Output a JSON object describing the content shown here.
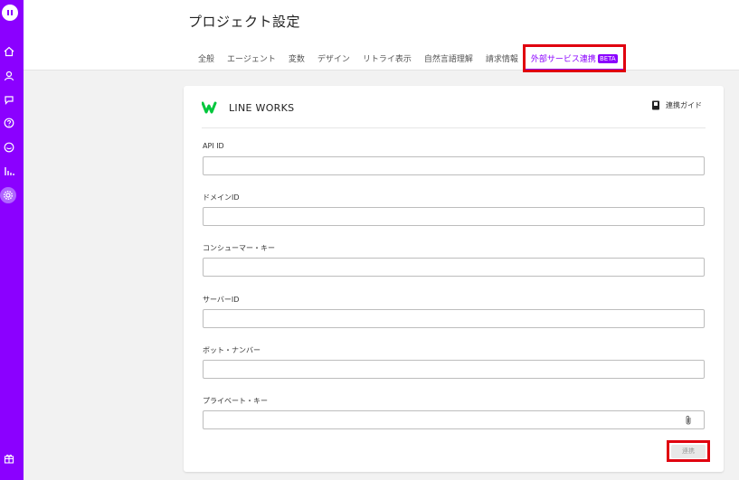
{
  "header": {
    "title": "プロジェクト設定",
    "tabs": [
      {
        "label": "全般"
      },
      {
        "label": "エージェント"
      },
      {
        "label": "変数"
      },
      {
        "label": "デザイン"
      },
      {
        "label": "リトライ表示"
      },
      {
        "label": "自然言語理解"
      },
      {
        "label": "請求情報"
      },
      {
        "label": "外部サービス連携",
        "badge": "BETA",
        "active": true
      }
    ]
  },
  "sidebar": {
    "items": [
      "home-icon",
      "user-icon",
      "chat-icon",
      "help-icon",
      "message-icon",
      "chart-icon",
      "settings-icon",
      "gift-icon"
    ],
    "accent": "#8b00ff"
  },
  "card": {
    "title": "LINE WORKS",
    "guide_label": "連携ガイド",
    "fields": [
      {
        "label": "API ID",
        "value": ""
      },
      {
        "label": "ドメインID",
        "value": ""
      },
      {
        "label": "コンシューマー・キー",
        "value": ""
      },
      {
        "label": "サーバーID",
        "value": ""
      },
      {
        "label": "ボット・ナンバー",
        "value": ""
      },
      {
        "label": "プライベート・キー",
        "value": ""
      }
    ],
    "submit_label": "連携"
  },
  "colors": {
    "brand": "#8b00ff",
    "line_works_green": "#00c73c",
    "highlight": "#e0000f"
  }
}
